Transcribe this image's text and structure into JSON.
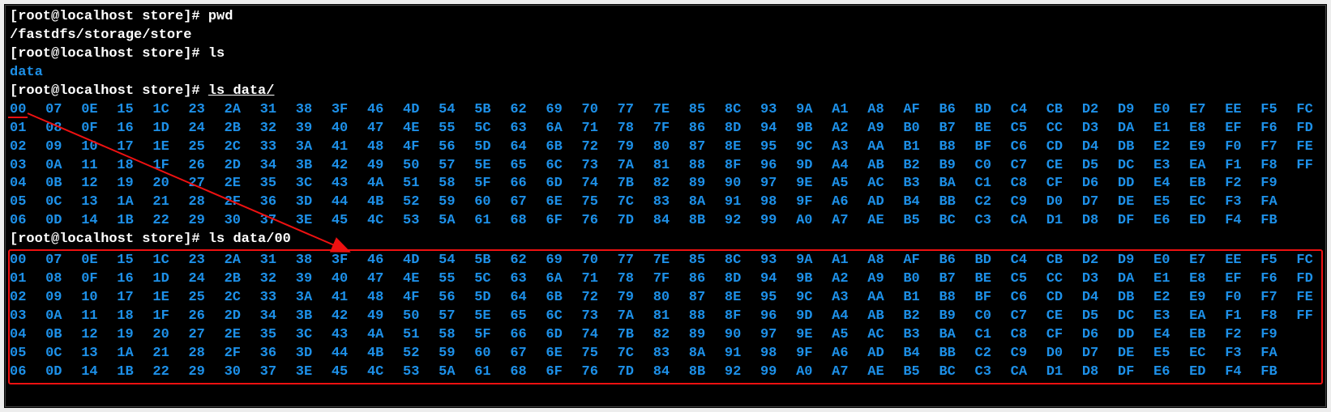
{
  "prompt": "[root@localhost store]# ",
  "lines": {
    "l1_cmd": "pwd",
    "l2_out": "/fastdfs/storage/store",
    "l3_cmd": "ls",
    "l4_out": "data",
    "l5_cmd_ls": "ls ",
    "l5_cmd_path": "data/",
    "l6_cmd": "ls data/00"
  },
  "grid1": [
    [
      "00",
      "07",
      "0E",
      "15",
      "1C",
      "23",
      "2A",
      "31",
      "38",
      "3F",
      "46",
      "4D",
      "54",
      "5B",
      "62",
      "69",
      "70",
      "77",
      "7E",
      "85",
      "8C",
      "93",
      "9A",
      "A1",
      "A8",
      "AF",
      "B6",
      "BD",
      "C4",
      "CB",
      "D2",
      "D9",
      "E0",
      "E7",
      "EE",
      "F5",
      "FC"
    ],
    [
      "01",
      "08",
      "0F",
      "16",
      "1D",
      "24",
      "2B",
      "32",
      "39",
      "40",
      "47",
      "4E",
      "55",
      "5C",
      "63",
      "6A",
      "71",
      "78",
      "7F",
      "86",
      "8D",
      "94",
      "9B",
      "A2",
      "A9",
      "B0",
      "B7",
      "BE",
      "C5",
      "CC",
      "D3",
      "DA",
      "E1",
      "E8",
      "EF",
      "F6",
      "FD"
    ],
    [
      "02",
      "09",
      "10",
      "17",
      "1E",
      "25",
      "2C",
      "33",
      "3A",
      "41",
      "48",
      "4F",
      "56",
      "5D",
      "64",
      "6B",
      "72",
      "79",
      "80",
      "87",
      "8E",
      "95",
      "9C",
      "A3",
      "AA",
      "B1",
      "B8",
      "BF",
      "C6",
      "CD",
      "D4",
      "DB",
      "E2",
      "E9",
      "F0",
      "F7",
      "FE"
    ],
    [
      "03",
      "0A",
      "11",
      "18",
      "1F",
      "26",
      "2D",
      "34",
      "3B",
      "42",
      "49",
      "50",
      "57",
      "5E",
      "65",
      "6C",
      "73",
      "7A",
      "81",
      "88",
      "8F",
      "96",
      "9D",
      "A4",
      "AB",
      "B2",
      "B9",
      "C0",
      "C7",
      "CE",
      "D5",
      "DC",
      "E3",
      "EA",
      "F1",
      "F8",
      "FF"
    ],
    [
      "04",
      "0B",
      "12",
      "19",
      "20",
      "27",
      "2E",
      "35",
      "3C",
      "43",
      "4A",
      "51",
      "58",
      "5F",
      "66",
      "6D",
      "74",
      "7B",
      "82",
      "89",
      "90",
      "97",
      "9E",
      "A5",
      "AC",
      "B3",
      "BA",
      "C1",
      "C8",
      "CF",
      "D6",
      "DD",
      "E4",
      "EB",
      "F2",
      "F9",
      ""
    ],
    [
      "05",
      "0C",
      "13",
      "1A",
      "21",
      "28",
      "2F",
      "36",
      "3D",
      "44",
      "4B",
      "52",
      "59",
      "60",
      "67",
      "6E",
      "75",
      "7C",
      "83",
      "8A",
      "91",
      "98",
      "9F",
      "A6",
      "AD",
      "B4",
      "BB",
      "C2",
      "C9",
      "D0",
      "D7",
      "DE",
      "E5",
      "EC",
      "F3",
      "FA",
      ""
    ],
    [
      "06",
      "0D",
      "14",
      "1B",
      "22",
      "29",
      "30",
      "37",
      "3E",
      "45",
      "4C",
      "53",
      "5A",
      "61",
      "68",
      "6F",
      "76",
      "7D",
      "84",
      "8B",
      "92",
      "99",
      "A0",
      "A7",
      "AE",
      "B5",
      "BC",
      "C3",
      "CA",
      "D1",
      "D8",
      "DF",
      "E6",
      "ED",
      "F4",
      "FB",
      ""
    ]
  ],
  "grid2": [
    [
      "00",
      "07",
      "0E",
      "15",
      "1C",
      "23",
      "2A",
      "31",
      "38",
      "3F",
      "46",
      "4D",
      "54",
      "5B",
      "62",
      "69",
      "70",
      "77",
      "7E",
      "85",
      "8C",
      "93",
      "9A",
      "A1",
      "A8",
      "AF",
      "B6",
      "BD",
      "C4",
      "CB",
      "D2",
      "D9",
      "E0",
      "E7",
      "EE",
      "F5",
      "FC"
    ],
    [
      "01",
      "08",
      "0F",
      "16",
      "1D",
      "24",
      "2B",
      "32",
      "39",
      "40",
      "47",
      "4E",
      "55",
      "5C",
      "63",
      "6A",
      "71",
      "78",
      "7F",
      "86",
      "8D",
      "94",
      "9B",
      "A2",
      "A9",
      "B0",
      "B7",
      "BE",
      "C5",
      "CC",
      "D3",
      "DA",
      "E1",
      "E8",
      "EF",
      "F6",
      "FD"
    ],
    [
      "02",
      "09",
      "10",
      "17",
      "1E",
      "25",
      "2C",
      "33",
      "3A",
      "41",
      "48",
      "4F",
      "56",
      "5D",
      "64",
      "6B",
      "72",
      "79",
      "80",
      "87",
      "8E",
      "95",
      "9C",
      "A3",
      "AA",
      "B1",
      "B8",
      "BF",
      "C6",
      "CD",
      "D4",
      "DB",
      "E2",
      "E9",
      "F0",
      "F7",
      "FE"
    ],
    [
      "03",
      "0A",
      "11",
      "18",
      "1F",
      "26",
      "2D",
      "34",
      "3B",
      "42",
      "49",
      "50",
      "57",
      "5E",
      "65",
      "6C",
      "73",
      "7A",
      "81",
      "88",
      "8F",
      "96",
      "9D",
      "A4",
      "AB",
      "B2",
      "B9",
      "C0",
      "C7",
      "CE",
      "D5",
      "DC",
      "E3",
      "EA",
      "F1",
      "F8",
      "FF"
    ],
    [
      "04",
      "0B",
      "12",
      "19",
      "20",
      "27",
      "2E",
      "35",
      "3C",
      "43",
      "4A",
      "51",
      "58",
      "5F",
      "66",
      "6D",
      "74",
      "7B",
      "82",
      "89",
      "90",
      "97",
      "9E",
      "A5",
      "AC",
      "B3",
      "BA",
      "C1",
      "C8",
      "CF",
      "D6",
      "DD",
      "E4",
      "EB",
      "F2",
      "F9",
      ""
    ],
    [
      "05",
      "0C",
      "13",
      "1A",
      "21",
      "28",
      "2F",
      "36",
      "3D",
      "44",
      "4B",
      "52",
      "59",
      "60",
      "67",
      "6E",
      "75",
      "7C",
      "83",
      "8A",
      "91",
      "98",
      "9F",
      "A6",
      "AD",
      "B4",
      "BB",
      "C2",
      "C9",
      "D0",
      "D7",
      "DE",
      "E5",
      "EC",
      "F3",
      "FA",
      ""
    ],
    [
      "06",
      "0D",
      "14",
      "1B",
      "22",
      "29",
      "30",
      "37",
      "3E",
      "45",
      "4C",
      "53",
      "5A",
      "61",
      "68",
      "6F",
      "76",
      "7D",
      "84",
      "8B",
      "92",
      "99",
      "A0",
      "A7",
      "AE",
      "B5",
      "BC",
      "C3",
      "CA",
      "D1",
      "D8",
      "DF",
      "E6",
      "ED",
      "F4",
      "FB",
      ""
    ]
  ]
}
